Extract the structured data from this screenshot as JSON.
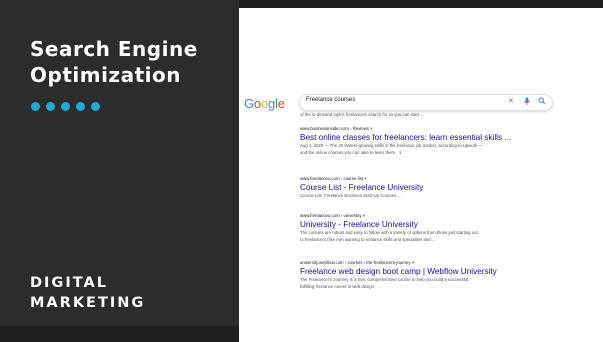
{
  "slide": {
    "title_line1": "Search Engine",
    "title_line2": "Optimization",
    "subtitle_line1": "DIGITAL",
    "subtitle_line2": "MARKETING",
    "dot_color": "#1ea9d6",
    "panel_color": "#2c2c2c"
  },
  "google": {
    "logo_letters": [
      {
        "char": "G",
        "color": "#4285f4"
      },
      {
        "char": "o",
        "color": "#ea4335"
      },
      {
        "char": "o",
        "color": "#fbbc05"
      },
      {
        "char": "g",
        "color": "#4285f4"
      },
      {
        "char": "l",
        "color": "#34a853"
      },
      {
        "char": "e",
        "color": "#ea4335"
      }
    ],
    "query": "Freelance courses",
    "icons": [
      "close-icon",
      "mic-icon",
      "search-icon"
    ],
    "top_snippet": "of the in-demand topics freelancers search for so you can start ...",
    "results": [
      {
        "breadcrumb": "www.businessinsider.com › Reviews",
        "title": "Best online classes for freelancers: learn essential skills ...",
        "snippet_line1": "Aug 1, 2020 — The 20 fastest-growing skills in the freelance job market, according to Upwork —",
        "snippet_line2": "and the online courses you can take to learn them · 1."
      },
      {
        "breadcrumb": "www.freelanceu.com › course-list",
        "title": "Course List - Freelance University",
        "snippet_line1": "Course List. Freelance Business Start-Up Courses ...",
        "snippet_line2": ""
      },
      {
        "breadcrumb": "www.freelanceu.com › university",
        "title": "University - Freelance University",
        "snippet_line1": "The courses are robust and easy to follow with a variety of options from those just starting out,",
        "snippet_line2": "to freelancers (like me) wanting to enhance skills and specialties and ..."
      },
      {
        "breadcrumb": "university.webflow.com › courses › the-freelancers-journey",
        "title": "Freelance web design boot camp | Webflow University",
        "snippet_line1": "The Freelancer's Journey is a free, comprehensive course to help you build a successful,",
        "snippet_line2": "fulfilling freelance career in web design."
      }
    ]
  }
}
